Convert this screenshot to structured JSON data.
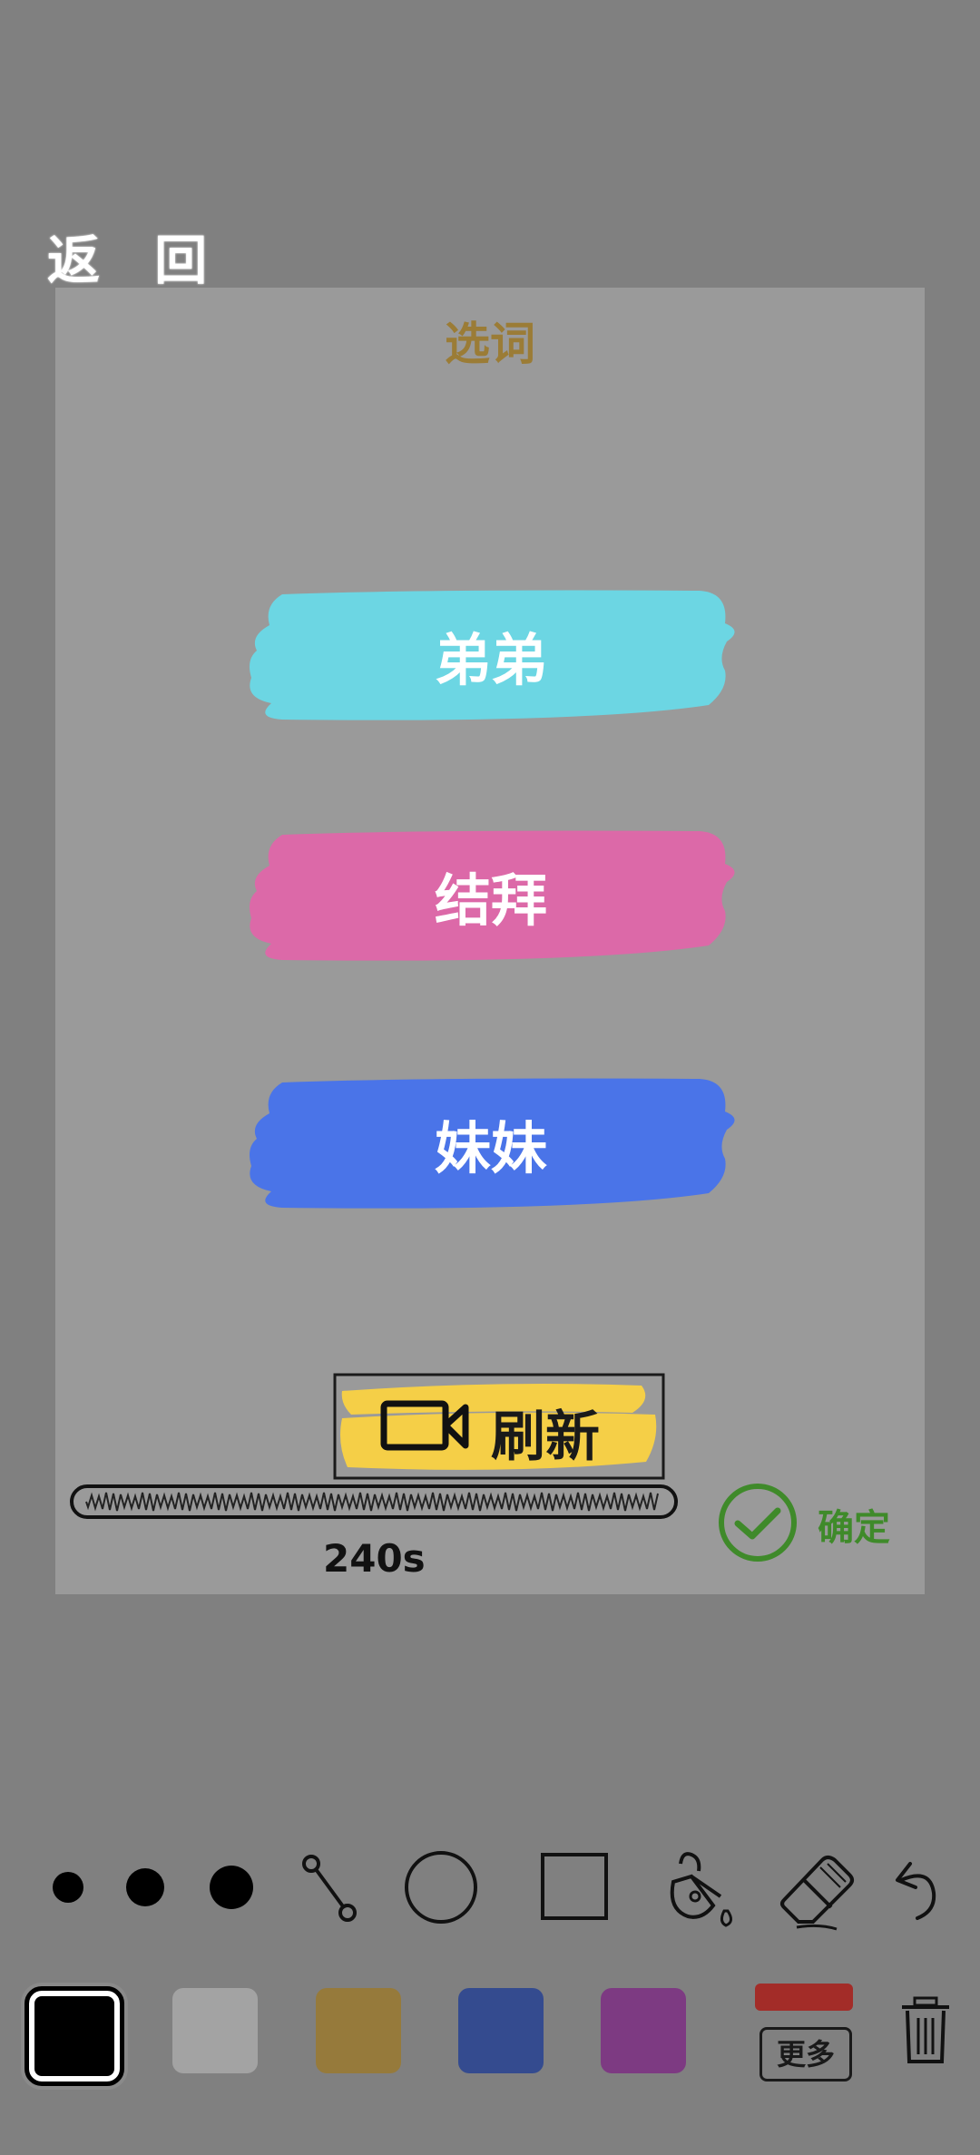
{
  "header": {
    "back_label": "返 回"
  },
  "panel": {
    "title": "选词",
    "words": [
      {
        "label": "弟弟",
        "color": "#6cd6e3"
      },
      {
        "label": "结拜",
        "color": "#dc69a8"
      },
      {
        "label": "妹妹",
        "color": "#4a74e8"
      }
    ],
    "refresh_label": "刷新",
    "timer": "240s",
    "confirm_label": "确定"
  },
  "toolbar": {
    "tools": [
      "brush-small-icon",
      "brush-medium-icon",
      "brush-large-icon",
      "line-tool-icon",
      "circle-tool-icon",
      "rectangle-tool-icon",
      "fill-bucket-icon",
      "eraser-icon",
      "undo-icon"
    ]
  },
  "palette": {
    "colors": [
      "#000000",
      "#a3a3a3",
      "#967a3b",
      "#344b8f",
      "#7d3a82"
    ],
    "more_label": "更多",
    "more_color": "#a32c28"
  }
}
